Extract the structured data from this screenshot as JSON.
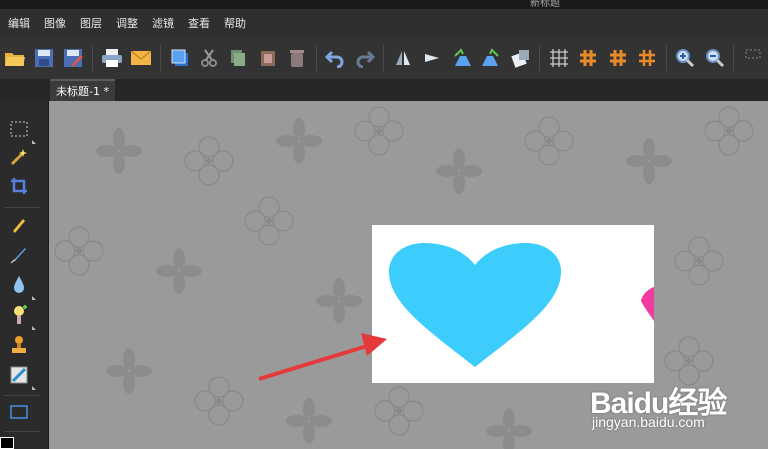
{
  "window": {
    "title": "新标题"
  },
  "menu": [
    "编辑",
    "图像",
    "图层",
    "调整",
    "滤镜",
    "查看",
    "帮助"
  ],
  "toolbar": {
    "items": [
      "open-icon",
      "save-icon",
      "save-as-icon",
      "print-icon",
      "email-icon",
      "layers-icon",
      "cut-icon",
      "copy-icon",
      "paste-icon",
      "delete-icon",
      "undo-icon",
      "redo-icon",
      "flip-horizontal-icon",
      "flip-vertical-icon",
      "rotate-left-icon",
      "rotate-right-icon",
      "resize-icon",
      "grid-icon",
      "hash-grid-icon",
      "hash-grid-2-icon",
      "hash-grid-3-icon",
      "zoom-in-icon",
      "zoom-out-icon",
      "fit-icon"
    ]
  },
  "tabs": [
    {
      "label": "未标题-1 *"
    }
  ],
  "left_tools": [
    "rectangle-select-icon",
    "magic-wand-icon",
    "crop-icon",
    "pencil-icon",
    "brush-icon",
    "blur-icon",
    "dodge-icon",
    "stamp-icon",
    "gradient-icon",
    "rectangle-shape-icon"
  ],
  "canvas": {
    "heart_color": "#3ccdfc",
    "partial_heart_color": "#f23b9e",
    "arrow_color": "#e5393b"
  },
  "watermark": {
    "brand": "Baidu经验",
    "url": "jingyan.baidu.com"
  }
}
